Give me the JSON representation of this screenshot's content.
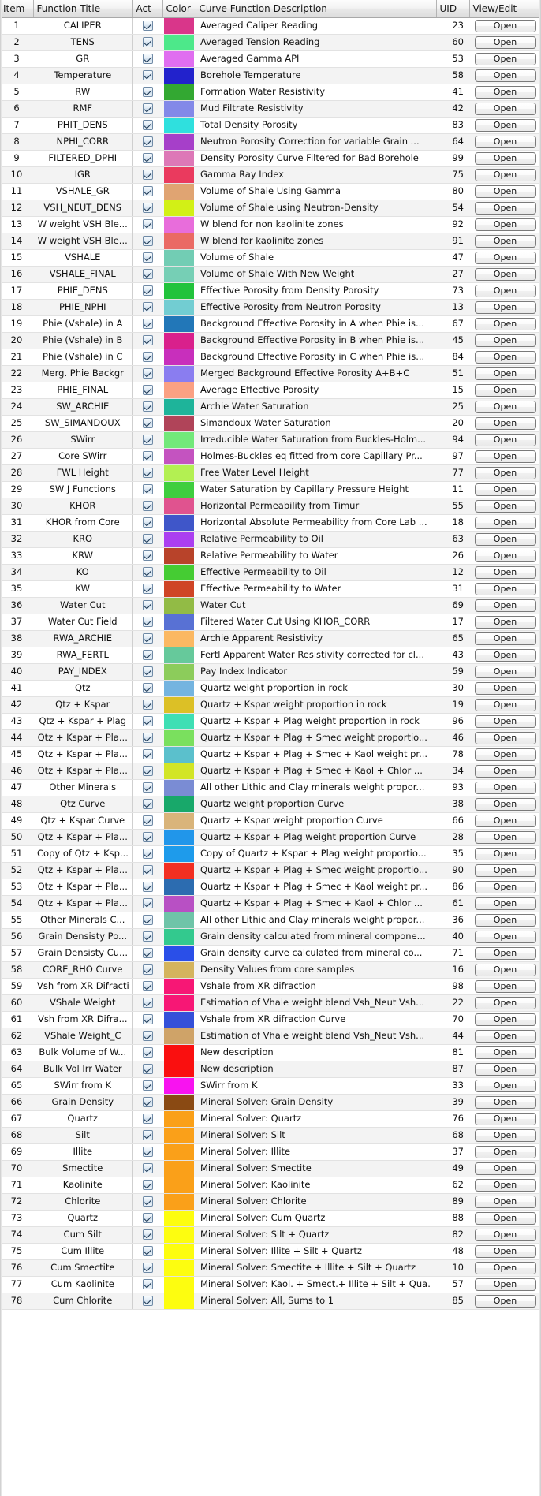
{
  "table": {
    "columns": [
      {
        "key": "item",
        "label": "Item"
      },
      {
        "key": "title",
        "label": "Function Title"
      },
      {
        "key": "act",
        "label": "Act"
      },
      {
        "key": "color",
        "label": "Color"
      },
      {
        "key": "desc",
        "label": "Curve Function Description"
      },
      {
        "key": "uid",
        "label": "UID"
      },
      {
        "key": "open",
        "label": "View/Edit"
      }
    ],
    "row_action_label": "Open",
    "checkbox_icon": "checkmark-icon",
    "rows": [
      {
        "item": "1",
        "title": "CALIPER",
        "act": true,
        "color": "#d9368a",
        "desc": "Averaged Caliper Reading",
        "uid": "23"
      },
      {
        "item": "2",
        "title": "TENS",
        "act": true,
        "color": "#4de88a",
        "desc": "Averaged Tension Reading",
        "uid": "60"
      },
      {
        "item": "3",
        "title": "GR",
        "act": true,
        "color": "#e06ef0",
        "desc": "Averaged Gamma API",
        "uid": "53"
      },
      {
        "item": "4",
        "title": "Temperature",
        "act": true,
        "color": "#2222cc",
        "desc": "Borehole Temperature",
        "uid": "58"
      },
      {
        "item": "5",
        "title": "RW",
        "act": true,
        "color": "#33a832",
        "desc": "Formation Water Resistivity",
        "uid": "41"
      },
      {
        "item": "6",
        "title": "RMF",
        "act": true,
        "color": "#8389e8",
        "desc": "Mud Filtrate Resistivity",
        "uid": "42"
      },
      {
        "item": "7",
        "title": "PHIT_DENS",
        "act": true,
        "color": "#2fe0de",
        "desc": "Total Density Porosity",
        "uid": "83"
      },
      {
        "item": "8",
        "title": "NPHI_CORR",
        "act": true,
        "color": "#a63fc9",
        "desc": "Neutron Porosity Correction for variable Grain ...",
        "uid": "64"
      },
      {
        "item": "9",
        "title": "FILTERED_DPHI",
        "act": true,
        "color": "#dd78b7",
        "desc": "Density Porosity Curve Filtered for Bad Borehole",
        "uid": "99"
      },
      {
        "item": "10",
        "title": "IGR",
        "act": true,
        "color": "#ea3a5e",
        "desc": "Gamma Ray Index",
        "uid": "75"
      },
      {
        "item": "11",
        "title": "VSHALE_GR",
        "act": true,
        "color": "#e0a472",
        "desc": "Volume of Shale Using Gamma",
        "uid": "80"
      },
      {
        "item": "12",
        "title": "VSH_NEUT_DENS",
        "act": true,
        "color": "#d2f016",
        "desc": "Volume of Shale using Neutron-Density",
        "uid": "54"
      },
      {
        "item": "13",
        "title": "W weight VSH Ble...",
        "act": true,
        "color": "#e86ddb",
        "desc": "W blend for non kaolinite zones",
        "uid": "92"
      },
      {
        "item": "14",
        "title": "W weight VSH Ble...",
        "act": true,
        "color": "#ea6a64",
        "desc": "W blend for kaolinite zones",
        "uid": "91"
      },
      {
        "item": "15",
        "title": "VSHALE",
        "act": true,
        "color": "#72cdb4",
        "desc": "Volume of Shale",
        "uid": "47"
      },
      {
        "item": "16",
        "title": "VSHALE_FINAL",
        "act": true,
        "color": "#76cfb5",
        "desc": "Volume of Shale With New Weight",
        "uid": "27"
      },
      {
        "item": "17",
        "title": "PHIE_DENS",
        "act": true,
        "color": "#22c33c",
        "desc": "Effective Porosity from Density Porosity",
        "uid": "73"
      },
      {
        "item": "18",
        "title": "PHIE_NPHI",
        "act": true,
        "color": "#72cdd2",
        "desc": "Effective Porosity from Neutron Porosity",
        "uid": "13"
      },
      {
        "item": "19",
        "title": "Phie (Vshale) in A",
        "act": true,
        "color": "#2277b8",
        "desc": "Background Effective Porosity in A when Phie is...",
        "uid": "67"
      },
      {
        "item": "20",
        "title": "Phie (Vshale) in B",
        "act": true,
        "color": "#d9208c",
        "desc": "Background Effective Porosity in B when Phie is...",
        "uid": "45"
      },
      {
        "item": "21",
        "title": "Phie (Vshale) in C",
        "act": true,
        "color": "#c82fbc",
        "desc": "Background Effective Porosity in C when Phie is...",
        "uid": "84"
      },
      {
        "item": "22",
        "title": "Merg. Phie Backgr",
        "act": true,
        "color": "#8a7df0",
        "desc": "Merged Background Effective Porosity A+B+C",
        "uid": "51"
      },
      {
        "item": "23",
        "title": "PHIE_FINAL",
        "act": true,
        "color": "#fba183",
        "desc": "Average Effective Porosity",
        "uid": "15"
      },
      {
        "item": "24",
        "title": "SW_ARCHIE",
        "act": true,
        "color": "#1eb49a",
        "desc": "Archie Water Saturation",
        "uid": "25"
      },
      {
        "item": "25",
        "title": "SW_SIMANDOUX",
        "act": true,
        "color": "#b04459",
        "desc": "Simandoux Water Saturation",
        "uid": "20"
      },
      {
        "item": "26",
        "title": "SWirr",
        "act": true,
        "color": "#72e87a",
        "desc": "Irreducible Water Saturation from Buckles-Holm...",
        "uid": "94"
      },
      {
        "item": "27",
        "title": "Core SWirr",
        "act": true,
        "color": "#c453c0",
        "desc": "Holmes-Buckles eq fitted from core Capillary Pr...",
        "uid": "97"
      },
      {
        "item": "28",
        "title": "FWL Height",
        "act": true,
        "color": "#b3f052",
        "desc": "Free Water Level Height",
        "uid": "77"
      },
      {
        "item": "29",
        "title": "SW J Functions",
        "act": true,
        "color": "#3fce3f",
        "desc": "Water Saturation by Capillary Pressure Height",
        "uid": "11"
      },
      {
        "item": "30",
        "title": "KHOR",
        "act": true,
        "color": "#e0538f",
        "desc": "Horizontal Permeability from Timur",
        "uid": "55"
      },
      {
        "item": "31",
        "title": "KHOR from Core",
        "act": true,
        "color": "#3f56c9",
        "desc": "Horizontal Absolute Permeability from Core Lab ...",
        "uid": "18"
      },
      {
        "item": "32",
        "title": "KRO",
        "act": true,
        "color": "#ab3ff0",
        "desc": "Relative Permeability to Oil",
        "uid": "63"
      },
      {
        "item": "33",
        "title": "KRW",
        "act": true,
        "color": "#b8432a",
        "desc": "Relative Permeability to Water",
        "uid": "26"
      },
      {
        "item": "34",
        "title": "KO",
        "act": true,
        "color": "#45cc33",
        "desc": "Effective Permeability to Oil",
        "uid": "12"
      },
      {
        "item": "35",
        "title": "KW",
        "act": true,
        "color": "#cf4526",
        "desc": "Effective Permeability to Water",
        "uid": "31"
      },
      {
        "item": "36",
        "title": "Water Cut",
        "act": true,
        "color": "#92bb45",
        "desc": "Water Cut",
        "uid": "69"
      },
      {
        "item": "37",
        "title": "Water Cut Field",
        "act": true,
        "color": "#5871d4",
        "desc": "Filtered Water Cut Using KHOR_CORR",
        "uid": "17"
      },
      {
        "item": "38",
        "title": "RWA_ARCHIE",
        "act": true,
        "color": "#fbb862",
        "desc": "Archie Apparent Resistivity",
        "uid": "65"
      },
      {
        "item": "39",
        "title": "RWA_FERTL",
        "act": true,
        "color": "#66c99b",
        "desc": "Fertl Apparent Water Resistivity corrected for cl...",
        "uid": "43"
      },
      {
        "item": "40",
        "title": "PAY_INDEX",
        "act": true,
        "color": "#8ccc5b",
        "desc": "Pay Index Indicator",
        "uid": "59"
      },
      {
        "item": "41",
        "title": "Qtz",
        "act": true,
        "color": "#74b4e0",
        "desc": "Quartz weight proportion in rock",
        "uid": "30"
      },
      {
        "item": "42",
        "title": "Qtz + Kspar",
        "act": true,
        "color": "#dcc026",
        "desc": "Quartz + Kspar weight proportion in rock",
        "uid": "19"
      },
      {
        "item": "43",
        "title": "Qtz + Kspar + Plag",
        "act": true,
        "color": "#3fdfb4",
        "desc": "Quartz + Kspar + Plag weight proportion in rock",
        "uid": "96"
      },
      {
        "item": "44",
        "title": "Qtz + Kspar + Pla...",
        "act": true,
        "color": "#7ae05e",
        "desc": "Quartz + Kspar + Plag + Smec weight proportio...",
        "uid": "46"
      },
      {
        "item": "45",
        "title": "Qtz + Kspar + Pla...",
        "act": true,
        "color": "#5bc0cc",
        "desc": "Quartz + Kspar + Plag + Smec + Kaol weight pr...",
        "uid": "78"
      },
      {
        "item": "46",
        "title": "Qtz + Kspar + Pla...",
        "act": true,
        "color": "#d2e526",
        "desc": "Quartz + Kspar + Plag + Smec + Kaol + Chlor ...",
        "uid": "34"
      },
      {
        "item": "47",
        "title": "Other Minerals",
        "act": true,
        "color": "#7a8cd4",
        "desc": "All other Lithic and Clay minerals weight propor...",
        "uid": "93"
      },
      {
        "item": "48",
        "title": "Qtz Curve",
        "act": true,
        "color": "#18a86a",
        "desc": "Quartz weight proportion Curve",
        "uid": "38"
      },
      {
        "item": "49",
        "title": "Qtz + Kspar Curve",
        "act": true,
        "color": "#d9b47a",
        "desc": "Quartz + Kspar weight proportion Curve",
        "uid": "66"
      },
      {
        "item": "50",
        "title": "Qtz + Kspar + Pla...",
        "act": true,
        "color": "#2196ea",
        "desc": "Quartz + Kspar + Plag weight proportion Curve",
        "uid": "28"
      },
      {
        "item": "51",
        "title": "Copy of Qtz + Ksp...",
        "act": true,
        "color": "#1e9beb",
        "desc": "Copy of Quartz + Kspar + Plag weight proportio...",
        "uid": "35"
      },
      {
        "item": "52",
        "title": "Qtz + Kspar + Pla...",
        "act": true,
        "color": "#f22f22",
        "desc": "Quartz + Kspar + Plag + Smec weight proportio...",
        "uid": "90"
      },
      {
        "item": "53",
        "title": "Qtz + Kspar + Pla...",
        "act": true,
        "color": "#2c6cb0",
        "desc": "Quartz + Kspar + Plag + Smec + Kaol weight pr...",
        "uid": "86"
      },
      {
        "item": "54",
        "title": "Qtz + Kspar + Pla...",
        "act": true,
        "color": "#b850c4",
        "desc": "Quartz + Kspar + Plag + Smec + Kaol + Chlor ...",
        "uid": "61"
      },
      {
        "item": "55",
        "title": "Other Minerals C...",
        "act": true,
        "color": "#6fc4a8",
        "desc": "All other Lithic and Clay minerals weight propor...",
        "uid": "36"
      },
      {
        "item": "56",
        "title": "Grain Densisty Po...",
        "act": true,
        "color": "#33c98e",
        "desc": "Grain density calculated from mineral compone...",
        "uid": "40"
      },
      {
        "item": "57",
        "title": "Grain Densisty Cu...",
        "act": true,
        "color": "#2a4fe8",
        "desc": "Grain density curve calculated from mineral co...",
        "uid": "71"
      },
      {
        "item": "58",
        "title": "CORE_RHO Curve",
        "act": true,
        "color": "#d4b45e",
        "desc": "Density Values from core samples",
        "uid": "16"
      },
      {
        "item": "59",
        "title": "Vsh from XR Difracti",
        "act": true,
        "color": "#f71775",
        "desc": "Vshale from XR difraction",
        "uid": "98"
      },
      {
        "item": "60",
        "title": "VShale Weight",
        "act": true,
        "color": "#f71775",
        "desc": "Estimation of Vhale weight blend Vsh_Neut Vsh...",
        "uid": "22"
      },
      {
        "item": "61",
        "title": "Vsh from XR Difra...",
        "act": true,
        "color": "#3450d9",
        "desc": "Vshale from XR difraction Curve",
        "uid": "70"
      },
      {
        "item": "62",
        "title": "VShale Weight_C",
        "act": true,
        "color": "#cfa368",
        "desc": "Estimation of Vhale weight blend Vsh_Neut Vsh...",
        "uid": "44"
      },
      {
        "item": "63",
        "title": "Bulk Volume of W...",
        "act": true,
        "color": "#fa0f0f",
        "desc": "New description",
        "uid": "81"
      },
      {
        "item": "64",
        "title": "Bulk Vol Irr Water",
        "act": true,
        "color": "#fa0f0f",
        "desc": "New description",
        "uid": "87"
      },
      {
        "item": "65",
        "title": "SWirr from K",
        "act": true,
        "color": "#f813f0",
        "desc": "SWirr from K",
        "uid": "33"
      },
      {
        "item": "66",
        "title": "Grain Density",
        "act": true,
        "color": "#8a4a13",
        "desc": "Mineral Solver: Grain Density",
        "uid": "39"
      },
      {
        "item": "67",
        "title": "Quartz",
        "act": true,
        "color": "#faa019",
        "desc": "Mineral Solver: Quartz",
        "uid": "76"
      },
      {
        "item": "68",
        "title": "Silt",
        "act": true,
        "color": "#faa019",
        "desc": "Mineral Solver: Silt",
        "uid": "68"
      },
      {
        "item": "69",
        "title": "Illite",
        "act": true,
        "color": "#faa019",
        "desc": "Mineral Solver: Illite",
        "uid": "37"
      },
      {
        "item": "70",
        "title": "Smectite",
        "act": true,
        "color": "#faa019",
        "desc": "Mineral Solver: Smectite",
        "uid": "49"
      },
      {
        "item": "71",
        "title": "Kaolinite",
        "act": true,
        "color": "#faa019",
        "desc": "Mineral Solver: Kaolinite",
        "uid": "62"
      },
      {
        "item": "72",
        "title": "Chlorite",
        "act": true,
        "color": "#faa019",
        "desc": "Mineral Solver: Chlorite",
        "uid": "89"
      },
      {
        "item": "73",
        "title": "Quartz",
        "act": true,
        "color": "#fdfd10",
        "desc": "Mineral Solver: Cum Quartz",
        "uid": "88"
      },
      {
        "item": "74",
        "title": "Cum Silt",
        "act": true,
        "color": "#fdfd10",
        "desc": "Mineral Solver: Silt + Quartz",
        "uid": "82"
      },
      {
        "item": "75",
        "title": "Cum Illite",
        "act": true,
        "color": "#fdfd10",
        "desc": "Mineral Solver: Illite + Silt + Quartz",
        "uid": "48"
      },
      {
        "item": "76",
        "title": "Cum Smectite",
        "act": true,
        "color": "#fdfd10",
        "desc": "Mineral Solver: Smectite + Illite + Silt + Quartz",
        "uid": "10"
      },
      {
        "item": "77",
        "title": "Cum Kaolinite",
        "act": true,
        "color": "#fdfd10",
        "desc": "Mineral Solver: Kaol. + Smect.+ Illite + Silt + Qua.",
        "uid": "57"
      },
      {
        "item": "78",
        "title": "Cum Chlorite",
        "act": true,
        "color": "#fdfd10",
        "desc": "Mineral Solver: All, Sums to 1",
        "uid": "85"
      }
    ]
  }
}
